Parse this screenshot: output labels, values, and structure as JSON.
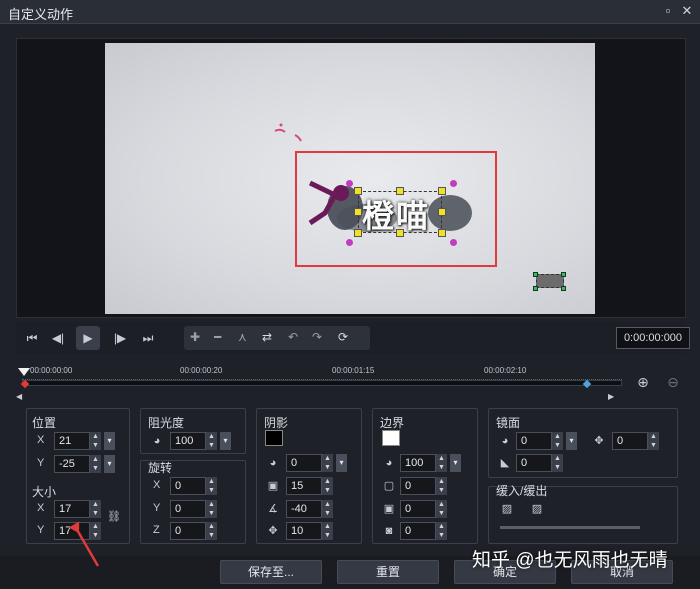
{
  "window": {
    "title": "自定义动作",
    "maximize_icon": "maximize-icon",
    "close_icon": "close-icon"
  },
  "preview": {
    "title_text": "橙喵"
  },
  "playback": {
    "timecode": "0:00:00:000",
    "buttons": [
      "go-start",
      "prev-frame",
      "play",
      "next-frame",
      "go-end"
    ]
  },
  "timeline": {
    "ticks": [
      "00:00:00:00",
      "00:00:00:20",
      "00:00:01:15",
      "00:00:02:10"
    ]
  },
  "position": {
    "label": "位置",
    "x_label": "X",
    "x": "21",
    "y_label": "Y",
    "y": "-25"
  },
  "size": {
    "label": "大小",
    "x_label": "X",
    "x": "17",
    "y_label": "Y",
    "y": "17"
  },
  "opacity": {
    "label": "阻光度",
    "value": "100"
  },
  "rotation": {
    "label": "旋转",
    "x_label": "X",
    "x": "0",
    "y_label": "Y",
    "y": "0",
    "z_label": "Z",
    "z": "0"
  },
  "shadow": {
    "label": "阴影",
    "color": "#000000",
    "opacity": "0",
    "blur": "15",
    "angle": "-40",
    "distance": "10"
  },
  "border": {
    "label": "边界",
    "color": "#ffffff",
    "opacity": "100",
    "width": "0",
    "blur": "0",
    "radius": "0"
  },
  "mirror": {
    "label": "镜面",
    "opacity": "0",
    "distance": "0",
    "fade": "0"
  },
  "ease": {
    "label": "缓入/缓出"
  },
  "buttons": {
    "save": "保存至...",
    "reset": "重置",
    "ok": "确定",
    "cancel": "取消"
  },
  "watermark": "知乎 @也无风雨也无晴",
  "colors": {
    "accent_red": "#e03a3a",
    "handle_yellow": "#f1e02a",
    "keyframe_blue": "#4fa3d8"
  }
}
